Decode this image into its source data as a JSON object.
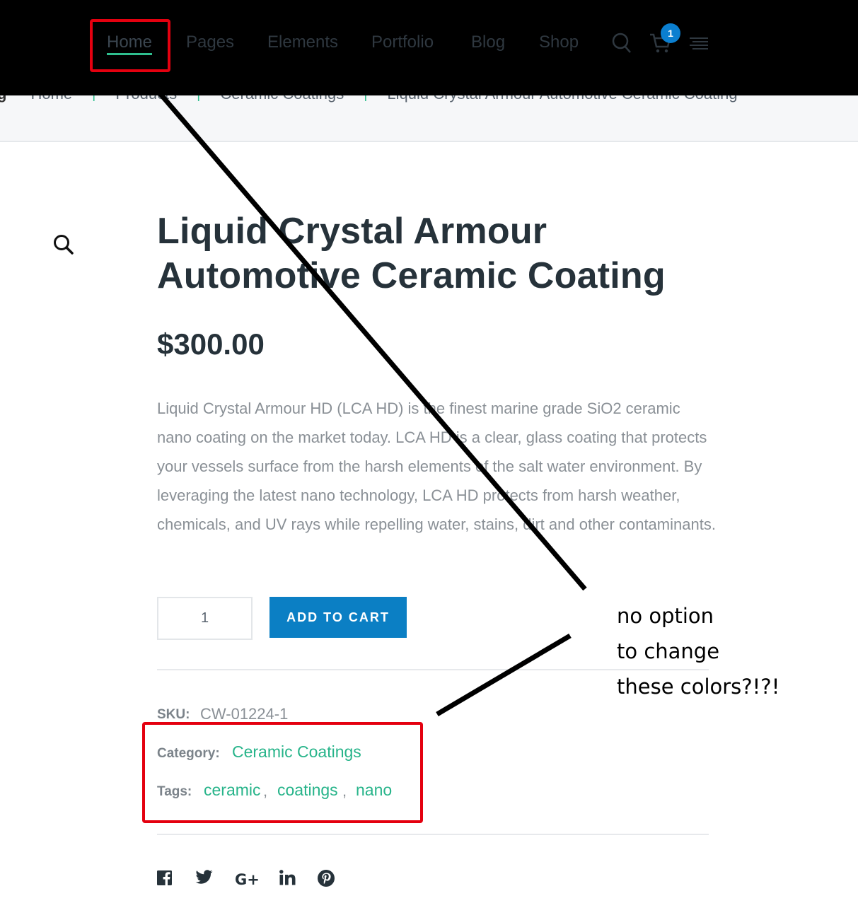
{
  "nav": {
    "items": [
      {
        "label": "Home",
        "active": true
      },
      {
        "label": "Pages"
      },
      {
        "label": "Elements"
      },
      {
        "label": "Portfolio"
      },
      {
        "label": "Blog"
      },
      {
        "label": "Shop"
      }
    ],
    "cart_count": "1",
    "icons": [
      "search-icon",
      "cart-icon",
      "menu-icon"
    ]
  },
  "breadcrumb": {
    "items": [
      "Home",
      "Products",
      "Ceramic Coatings",
      "Liquid Crystal Armour Automotive Ceramic Coating"
    ]
  },
  "product": {
    "title": "Liquid Crystal Armour Automotive Ceramic Coating",
    "price": "$300.00",
    "description": "Liquid Crystal Armour HD (LCA HD) is the finest marine grade SiO2 ceramic nano coating on the market today. LCA HD is a clear, glass coating that protects your vessels surface from the harsh elements of the salt water environment. By leveraging the latest nano technology, LCA HD protects from harsh weather, chemicals, and UV rays while repelling water, stains, dirt and other contaminants.",
    "quantity": "1",
    "add_to_cart_label": "ADD TO CART",
    "sku_label": "SKU:",
    "sku": "CW-01224-1",
    "category_label": "Category:",
    "category": "Ceramic Coatings",
    "tags_label": "Tags:",
    "tags": [
      "ceramic",
      "coatings",
      "nano"
    ],
    "tag_separator": ","
  },
  "social": [
    "facebook-icon",
    "twitter-icon",
    "google-plus-icon",
    "linkedin-icon",
    "pinterest-icon"
  ],
  "annotation": {
    "lines": [
      "no option",
      "to change",
      "these colors?!?!"
    ]
  },
  "colors": {
    "accent_green": "#27b48a",
    "button_blue": "#0b7fc4",
    "annotation_red": "#e4000f",
    "nav_bg": "#000000"
  }
}
